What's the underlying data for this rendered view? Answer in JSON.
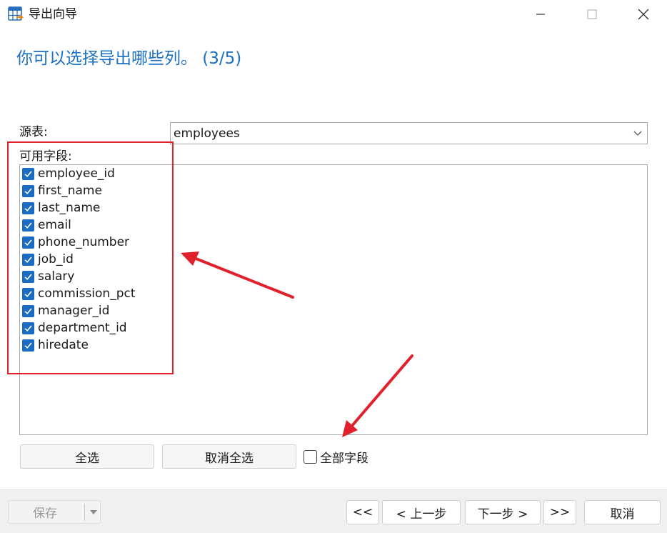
{
  "window": {
    "title": "导出向导",
    "controls": {
      "minimize": "minimize",
      "maximize": "maximize",
      "close": "close"
    }
  },
  "step_title": "你可以选择导出哪些列。 (3/5)",
  "source": {
    "label": "源表:",
    "value": "employees"
  },
  "fields": {
    "label": "可用字段:",
    "items": [
      {
        "label": "employee_id",
        "checked": true
      },
      {
        "label": "first_name",
        "checked": true
      },
      {
        "label": "last_name",
        "checked": true
      },
      {
        "label": "email",
        "checked": true
      },
      {
        "label": "phone_number",
        "checked": true
      },
      {
        "label": "job_id",
        "checked": true
      },
      {
        "label": "salary",
        "checked": true
      },
      {
        "label": "commission_pct",
        "checked": true
      },
      {
        "label": "manager_id",
        "checked": true
      },
      {
        "label": "department_id",
        "checked": true
      },
      {
        "label": "hiredate",
        "checked": true
      }
    ]
  },
  "actions": {
    "select_all": "全选",
    "deselect_all": "取消全选",
    "all_fields": {
      "label": "全部字段",
      "checked": false
    }
  },
  "footer": {
    "save": "保存",
    "first": "<<",
    "prev": "< 上一步",
    "next": "下一步 >",
    "last": ">>",
    "cancel": "取消"
  },
  "colors": {
    "title_blue": "#1c6fc2",
    "checkbox_blue": "#1a6bc4",
    "annotation_red": "#e0202a"
  }
}
